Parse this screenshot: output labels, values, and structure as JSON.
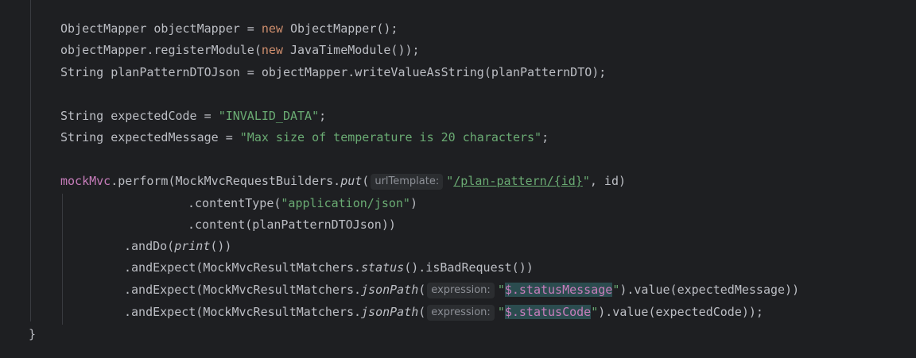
{
  "editor": {
    "lines": {
      "l1": {
        "type": "ObjectMapper",
        "var": " objectMapper = ",
        "kw": "new",
        "rest": " ObjectMapper();"
      },
      "l2": {
        "pre": "objectMapper.registerModule(",
        "kw": "new",
        "rest": " JavaTimeModule());"
      },
      "l3": {
        "text": "String planPatternDTOJson = objectMapper.writeValueAsString(planPatternDTO);"
      },
      "l4": {
        "pre": "String expectedCode = ",
        "str": "\"INVALID_DATA\"",
        "post": ";"
      },
      "l5": {
        "pre": "String expectedMessage = ",
        "str": "\"Max size of temperature is 20 characters\"",
        "post": ";"
      },
      "l6": {
        "field": "mockMvc",
        "pre": ".perform(MockMvcRequestBuilders.",
        "method": "put",
        "paren": "(",
        "hint": "urlTemplate:",
        "q1": "\"",
        "url": "/plan-pattern/{id}",
        "q2": "\"",
        "post": ", id)"
      },
      "l7": {
        "pre": ".contentType(",
        "str": "\"application/json\"",
        "post": ")"
      },
      "l8": {
        "text": ".content(planPatternDTOJson))"
      },
      "l9": {
        "pre": ".andDo(",
        "method": "print",
        "post": "())"
      },
      "l10": {
        "pre": ".andExpect(MockMvcResultMatchers.",
        "method": "status",
        "post": "().isBadRequest())"
      },
      "l11": {
        "pre": ".andExpect(MockMvcResultMatchers.",
        "method": "jsonPath",
        "paren": "(",
        "hint": "expression:",
        "q1": "\"",
        "path": "$.statusMessage",
        "q2": "\"",
        "post": ").value(expectedMessage))"
      },
      "l12": {
        "pre": ".andExpect(MockMvcResultMatchers.",
        "method": "jsonPath",
        "paren": "(",
        "hint": "expression:",
        "q1": "\"",
        "path": "$.statusCode",
        "q2": "\"",
        "post": ").value(expectedCode));"
      },
      "l13": {
        "text": "}"
      }
    }
  },
  "colors": {
    "background": "#1e1f22",
    "text": "#bcbec4",
    "keyword": "#cf8e6d",
    "string": "#6aab73",
    "field": "#c77dbb",
    "hint_bg": "#2b2d30",
    "hint_text": "#8c8f96",
    "highlight": "#2b4c4f"
  }
}
